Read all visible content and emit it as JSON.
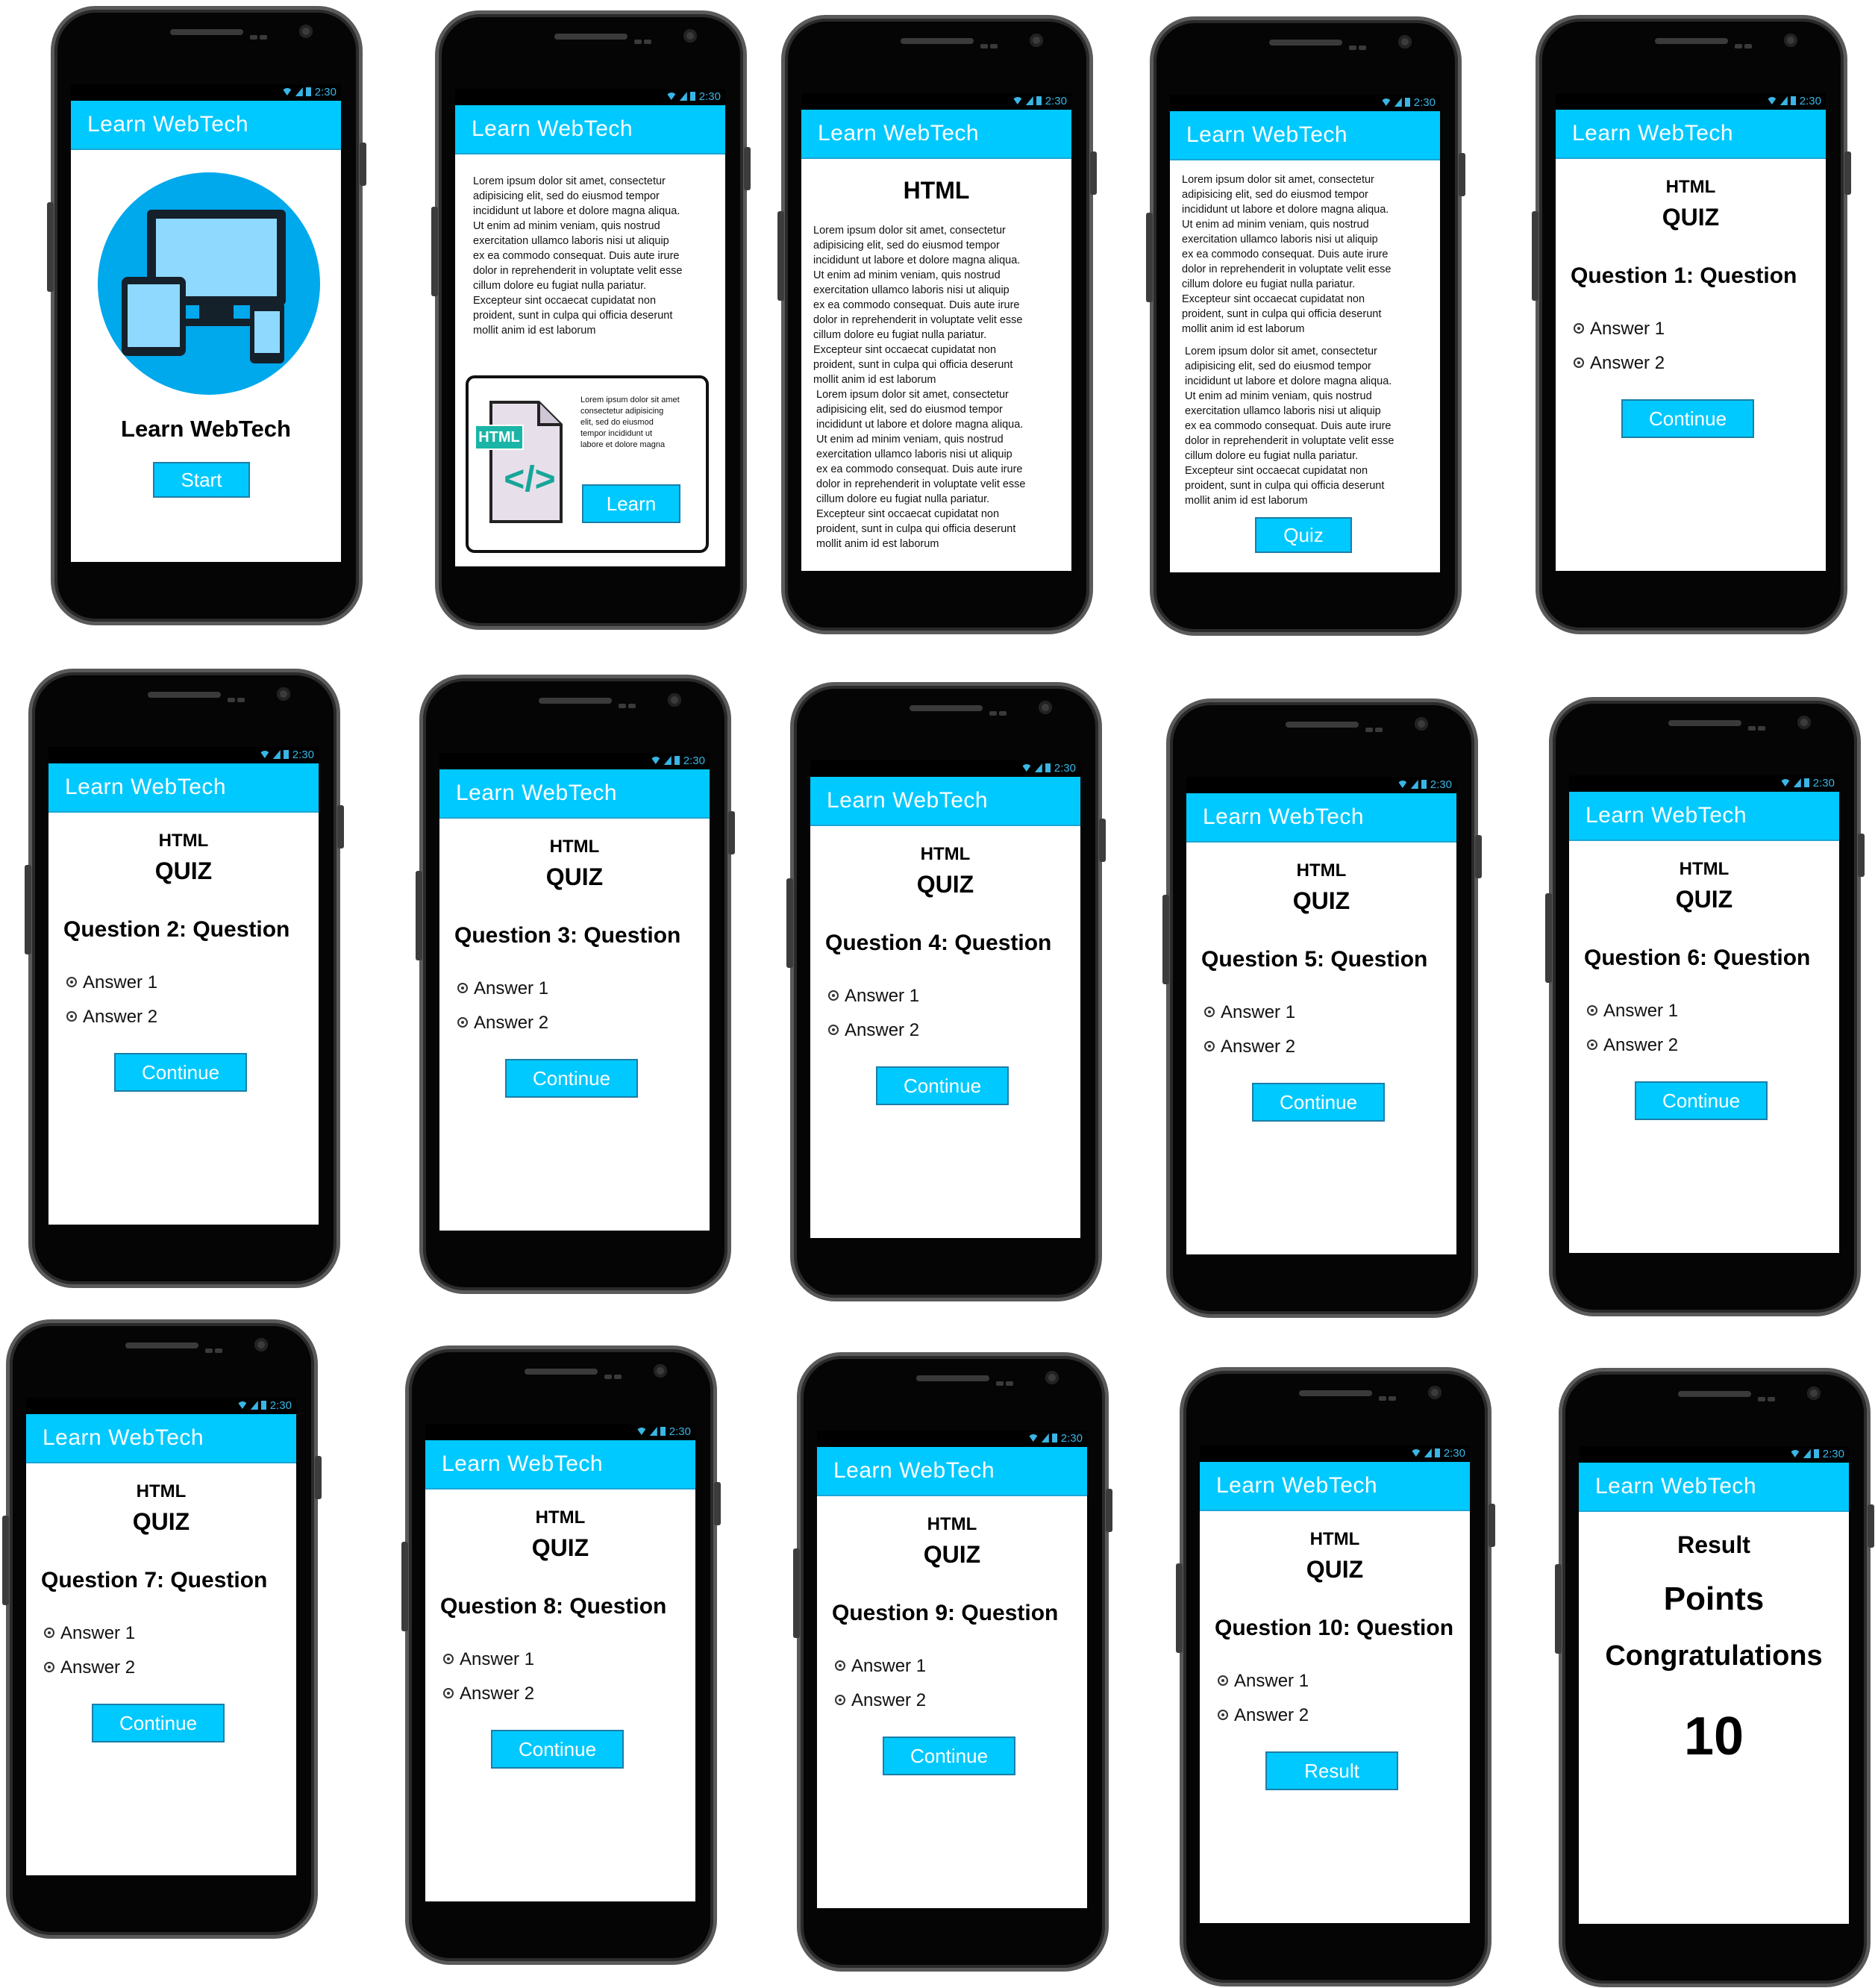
{
  "colors": {
    "accent": "#00c9ff",
    "status_icon": "#39b6e6"
  },
  "status": {
    "time": "2:30"
  },
  "app": {
    "title": "Learn WebTech"
  },
  "screen1": {
    "heading": "Learn WebTech",
    "button": "Start",
    "illustration": "responsive-devices-icon"
  },
  "screen2": {
    "paragraph": "Lorem ipsum dolor sit amet, consectetur\nadipisicing elit, sed do eiusmod tempor\nincididunt ut labore et dolore magna aliqua.\nUt enim ad minim veniam, quis nostrud\nexercitation ullamco laboris nisi ut aliquip\nex ea commodo consequat. Duis aute irure\ndolor in reprehenderit in voluptate velit esse\ncillum dolore eu fugiat nulla pariatur.\nExcepteur sint occaecat cupidatat non\nproident, sunt in culpa qui officia deserunt\nmollit anim id est laborum",
    "card_text": "Lorem ipsum dolor sit amet\nconsectetur adipisicing\nelit, sed do eiusmod\ntempor incididunt ut\nlabore et dolore magna",
    "card_badge": "HTML",
    "card_code": "</>",
    "button": "Learn"
  },
  "screen3": {
    "heading": "HTML",
    "paragraph1": "Lorem ipsum dolor sit amet, consectetur\nadipisicing elit, sed do eiusmod tempor\nincididunt ut labore et dolore magna aliqua.\nUt enim ad minim veniam, quis nostrud\nexercitation ullamco laboris nisi ut aliquip\nex ea commodo consequat. Duis aute irure\ndolor in reprehenderit in voluptate velit esse\ncillum dolore eu fugiat nulla pariatur.\nExcepteur sint occaecat cupidatat non\nproident, sunt in culpa qui officia deserunt\nmollit anim id est laborum",
    "paragraph2": "Lorem ipsum dolor sit amet, consectetur\nadipisicing elit, sed do eiusmod tempor\nincididunt ut labore et dolore magna aliqua.\nUt enim ad minim veniam, quis nostrud\nexercitation ullamco laboris nisi ut aliquip\nex ea commodo consequat. Duis aute irure\ndolor in reprehenderit in voluptate velit esse\ncillum dolore eu fugiat nulla pariatur.\nExcepteur sint occaecat cupidatat non\nproident, sunt in culpa qui officia deserunt\nmollit anim id est laborum"
  },
  "screen4": {
    "paragraph1": "Lorem ipsum dolor sit amet, consectetur\nadipisicing elit, sed do eiusmod tempor\nincididunt ut labore et dolore magna aliqua.\nUt enim ad minim veniam, quis nostrud\nexercitation ullamco laboris nisi ut aliquip\nex ea commodo consequat. Duis aute irure\ndolor in reprehenderit in voluptate velit esse\ncillum dolore eu fugiat nulla pariatur.\nExcepteur sint occaecat cupidatat non\nproident, sunt in culpa qui officia deserunt\nmollit anim id est laborum",
    "paragraph2": "Lorem ipsum dolor sit amet, consectetur\nadipisicing elit, sed do eiusmod tempor\nincididunt ut labore et dolore magna aliqua.\nUt enim ad minim veniam, quis nostrud\nexercitation ullamco laboris nisi ut aliquip\nex ea commodo consequat. Duis aute irure\ndolor in reprehenderit in voluptate velit esse\ncillum dolore eu fugiat nulla pariatur.\nExcepteur sint occaecat cupidatat non\nproident, sunt in culpa qui officia deserunt\nmollit anim id est laborum",
    "button": "Quiz"
  },
  "quiz": {
    "subject": "HTML",
    "title": "QUIZ",
    "answer1": "Answer 1",
    "answer2": "Answer 2",
    "continue": "Continue",
    "result_button": "Result",
    "questions": [
      "Question 1: Question",
      "Question 2: Question",
      "Question 3: Question",
      "Question 4: Question",
      "Question 5: Question",
      "Question 6: Question",
      "Question 7: Question",
      "Question 8: Question",
      "Question 9: Question",
      "Question 10: Question"
    ]
  },
  "result": {
    "title": "Result",
    "points_label": "Points",
    "message": "Congratulations",
    "score": "10"
  }
}
